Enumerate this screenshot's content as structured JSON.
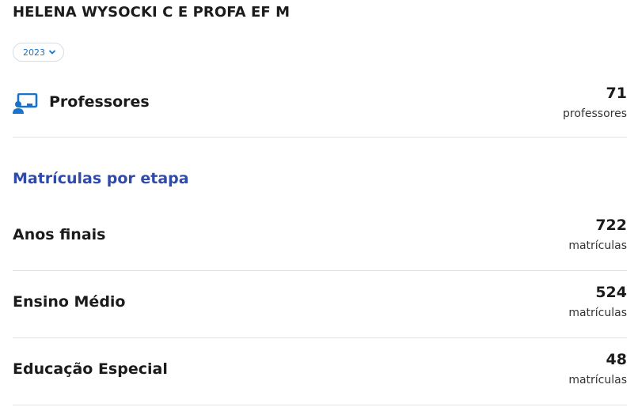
{
  "header": {
    "school_name": "HELENA WYSOCKI C E PROFA EF M"
  },
  "year_select": {
    "selected": "2023",
    "icon": "chevron-down-icon"
  },
  "professores": {
    "icon": "teacher-board-icon",
    "label": "Professores",
    "value": "71",
    "unit": "professores"
  },
  "matriculas": {
    "title": "Matrículas por etapa",
    "stages": [
      {
        "label": "Anos finais",
        "value": "722",
        "unit": "matrículas"
      },
      {
        "label": "Ensino Médio",
        "value": "524",
        "unit": "matrículas"
      },
      {
        "label": "Educação Especial",
        "value": "48",
        "unit": "matrículas"
      }
    ]
  },
  "colors": {
    "accent_blue": "#1a73c8",
    "section_title": "#2f4aa8",
    "divider": "#e3e3e3"
  }
}
